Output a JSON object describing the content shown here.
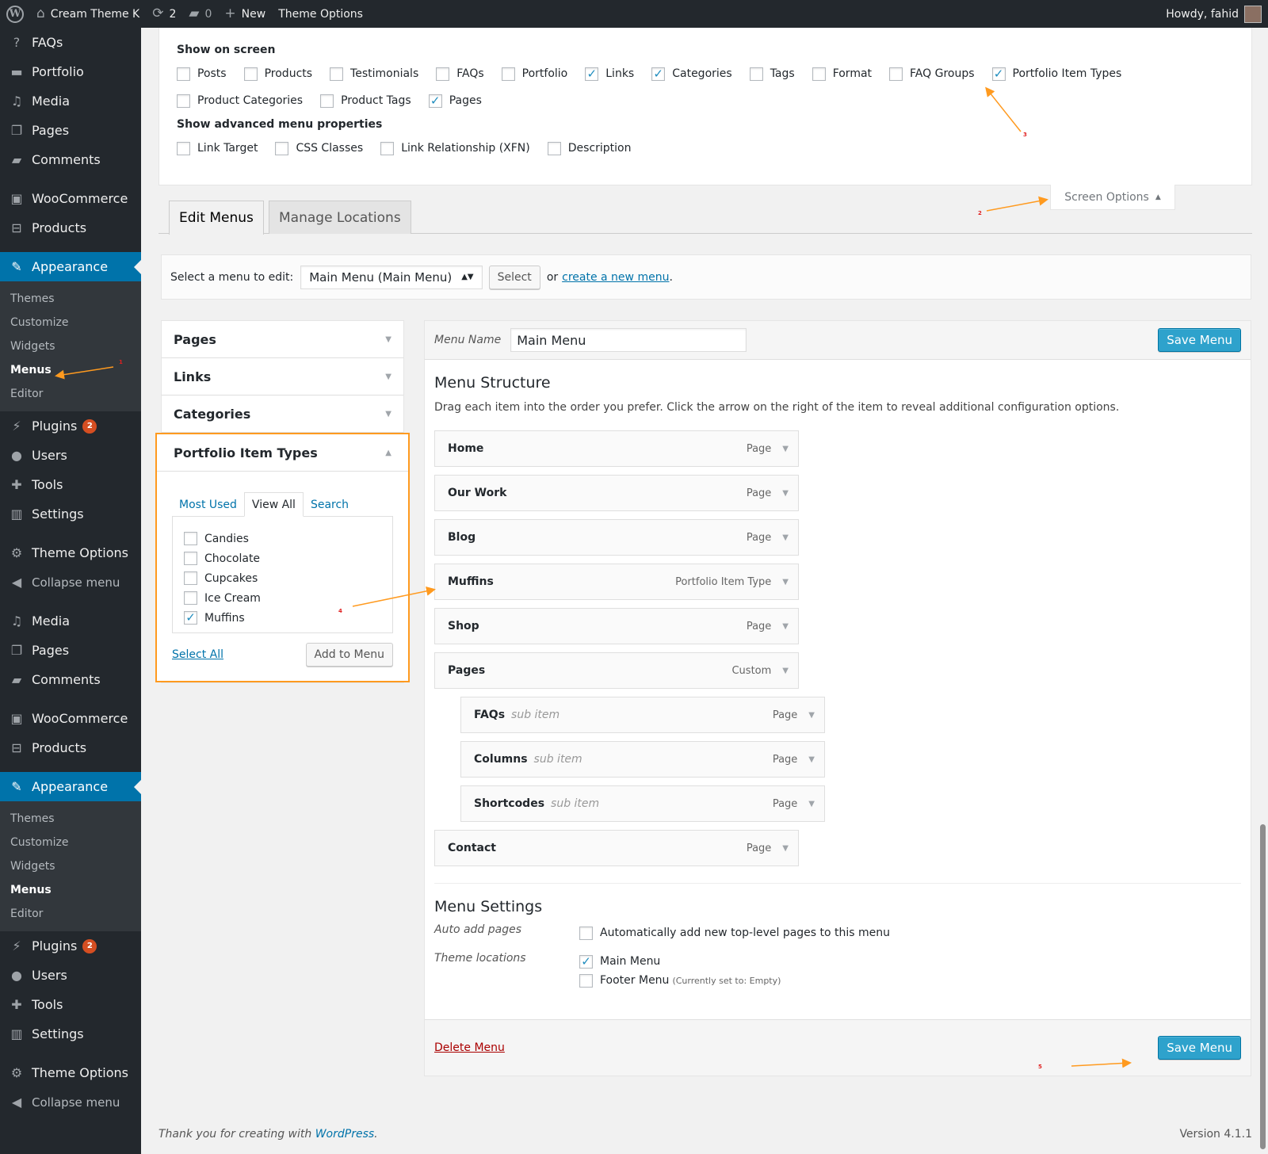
{
  "adminbar": {
    "site_name": "Cream Theme K",
    "updates_count": "2",
    "comments_count": "0",
    "new_label": "New",
    "theme_options_label": "Theme Options",
    "howdy": "Howdy, fahid"
  },
  "sidebar": {
    "top": [
      {
        "label": "FAQs",
        "icon": "help-icon"
      },
      {
        "label": "Portfolio",
        "icon": "folder-icon"
      },
      {
        "label": "Media",
        "icon": "media-icon"
      },
      {
        "label": "Pages",
        "icon": "pages-icon"
      },
      {
        "label": "Comments",
        "icon": "comments-icon"
      }
    ],
    "woo": [
      {
        "label": "WooCommerce",
        "icon": "woo-icon"
      },
      {
        "label": "Products",
        "icon": "products-icon"
      }
    ],
    "appearance": "Appearance",
    "submenu": [
      "Themes",
      "Customize",
      "Widgets",
      "Menus",
      "Editor"
    ],
    "lower": [
      {
        "label": "Plugins",
        "badge": "2"
      },
      {
        "label": "Users"
      },
      {
        "label": "Tools"
      },
      {
        "label": "Settings"
      }
    ],
    "theme_options": "Theme Options",
    "collapse": "Collapse menu",
    "top2": [
      {
        "label": "Media"
      },
      {
        "label": "Pages"
      },
      {
        "label": "Comments"
      }
    ],
    "woo2": [
      {
        "label": "WooCommerce"
      },
      {
        "label": "Products"
      }
    ],
    "appearance2": "Appearance",
    "submenu2": [
      "Themes",
      "Customize",
      "Widgets",
      "Menus",
      "Editor"
    ],
    "lower2": [
      {
        "label": "Plugins",
        "badge": "2"
      },
      {
        "label": "Users"
      },
      {
        "label": "Tools"
      },
      {
        "label": "Settings"
      }
    ],
    "theme_options2": "Theme Options",
    "collapse2": "Collapse menu"
  },
  "screen_options": {
    "show_on_screen": "Show on screen",
    "boxes": [
      {
        "label": "Posts",
        "checked": false
      },
      {
        "label": "Products",
        "checked": false
      },
      {
        "label": "Testimonials",
        "checked": false
      },
      {
        "label": "FAQs",
        "checked": false
      },
      {
        "label": "Portfolio",
        "checked": false
      },
      {
        "label": "Links",
        "checked": true
      },
      {
        "label": "Categories",
        "checked": true
      },
      {
        "label": "Tags",
        "checked": false
      },
      {
        "label": "Format",
        "checked": false
      },
      {
        "label": "FAQ Groups",
        "checked": false
      },
      {
        "label": "Portfolio Item Types",
        "checked": true
      },
      {
        "label": "Product Categories",
        "checked": false
      },
      {
        "label": "Product Tags",
        "checked": false
      },
      {
        "label": "Pages",
        "checked": true
      }
    ],
    "advanced_title": "Show advanced menu properties",
    "advanced": [
      {
        "label": "Link Target",
        "checked": false
      },
      {
        "label": "CSS Classes",
        "checked": false
      },
      {
        "label": "Link Relationship (XFN)",
        "checked": false
      },
      {
        "label": "Description",
        "checked": false
      }
    ],
    "tab_label": "Screen Options"
  },
  "tabs": {
    "edit": "Edit Menus",
    "manage": "Manage Locations"
  },
  "select_bar": {
    "label": "Select a menu to edit:",
    "selected": "Main Menu (Main Menu)",
    "select_btn": "Select",
    "or": "or",
    "create_link": "create a new menu",
    "period": "."
  },
  "accordion": {
    "sections": [
      "Pages",
      "Links",
      "Categories"
    ],
    "open_title": "Portfolio Item Types",
    "tabs": [
      "Most Used",
      "View All",
      "Search"
    ],
    "items": [
      {
        "label": "Candies",
        "checked": false
      },
      {
        "label": "Chocolate",
        "checked": false
      },
      {
        "label": "Cupcakes",
        "checked": false
      },
      {
        "label": "Ice Cream",
        "checked": false
      },
      {
        "label": "Muffins",
        "checked": true
      }
    ],
    "select_all": "Select All",
    "add_btn": "Add to Menu"
  },
  "menu": {
    "name_label": "Menu Name",
    "name_value": "Main Menu",
    "save": "Save Menu",
    "structure_title": "Menu Structure",
    "structure_desc": "Drag each item into the order you prefer. Click the arrow on the right of the item to reveal additional configuration options.",
    "items": [
      {
        "name": "Home",
        "type": "Page",
        "sub": ""
      },
      {
        "name": "Our Work",
        "type": "Page",
        "sub": ""
      },
      {
        "name": "Blog",
        "type": "Page",
        "sub": ""
      },
      {
        "name": "Muffins",
        "type": "Portfolio Item Type",
        "sub": ""
      },
      {
        "name": "Shop",
        "type": "Page",
        "sub": ""
      },
      {
        "name": "Pages",
        "type": "Custom",
        "sub": ""
      },
      {
        "name": "FAQs",
        "type": "Page",
        "sub": "sub item"
      },
      {
        "name": "Columns",
        "type": "Page",
        "sub": "sub item"
      },
      {
        "name": "Shortcodes",
        "type": "Page",
        "sub": "sub item"
      },
      {
        "name": "Contact",
        "type": "Page",
        "sub": ""
      }
    ],
    "settings_title": "Menu Settings",
    "auto_add_label": "Auto add pages",
    "auto_add_text": "Automatically add new top-level pages to this menu",
    "locations_label": "Theme locations",
    "loc_main": "Main Menu",
    "loc_footer": "Footer Menu",
    "loc_footer_note": "(Currently set to: Empty)",
    "delete": "Delete Menu"
  },
  "annotations": [
    "1",
    "2",
    "3",
    "4",
    "5"
  ],
  "footer": {
    "thanks": "Thank you for creating with",
    "wordpress": "WordPress",
    "period": ".",
    "version": "Version 4.1.1"
  },
  "colors": {
    "accent": "#0073aa",
    "highlight": "#ff9a1f",
    "admin_dark": "#23282d"
  }
}
